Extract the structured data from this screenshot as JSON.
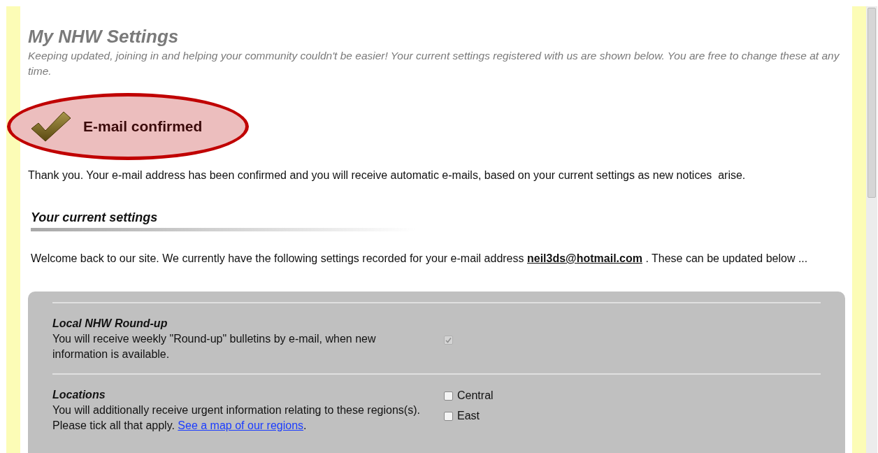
{
  "page": {
    "title": "My NHW Settings",
    "intro": "Keeping updated, joining in and helping your community couldn't be easier! Your current settings registered with us are shown below. You are free to change these at any time."
  },
  "confirmation": {
    "label": "E-mail confirmed",
    "message": "Thank you. Your e-mail address has been confirmed and you will receive automatic e-mails, based on your current settings as new notices  arise."
  },
  "current_settings": {
    "heading": "Your current settings",
    "welcome_before": "Welcome back to our site. We currently have the following settings recorded for your e-mail address",
    "email": "neil3ds@hotmail.com",
    "welcome_after": ". These can be updated below ..."
  },
  "settings": [
    {
      "kind": "single",
      "title": "Local NHW Round-up",
      "description": "You will receive weekly \"Round-up\" bulletins by e-mail, when new information is available.",
      "checked": true,
      "disabled": true
    },
    {
      "kind": "list",
      "title": "Locations",
      "description": "You will additionally receive urgent information relating to these regions(s). Please tick all that apply.",
      "link": "See a map of our regions",
      "link_suffix": ".",
      "options": [
        {
          "label": "Central",
          "checked": false
        },
        {
          "label": "East",
          "checked": false
        }
      ]
    }
  ]
}
